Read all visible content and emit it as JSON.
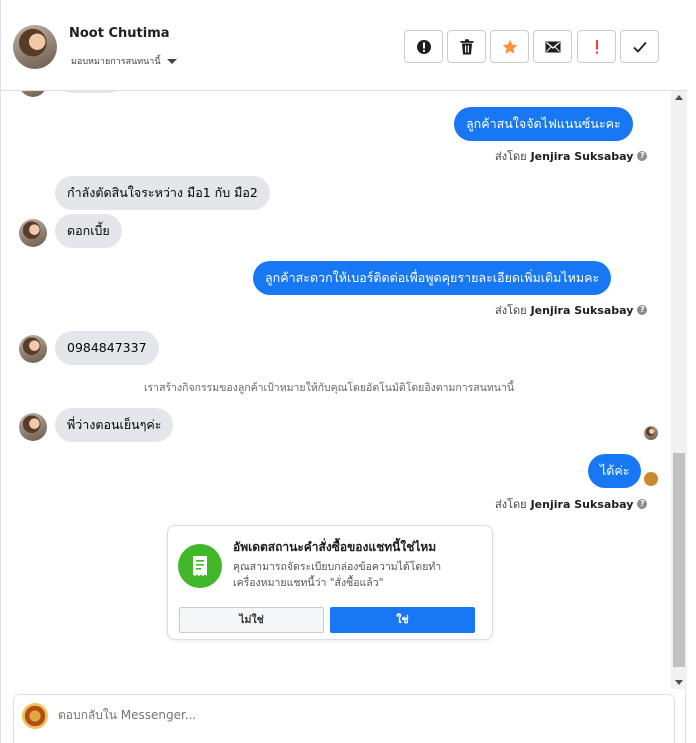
{
  "header": {
    "name": "Noot Chutima",
    "assign": "มอบหมายการสนทนานี้",
    "actions": [
      {
        "name": "mark-spam-button",
        "icon": "exclamation-circle-icon",
        "color": "#1c1e21"
      },
      {
        "name": "delete-button",
        "icon": "trash-icon",
        "color": "#1c1e21"
      },
      {
        "name": "star-button",
        "icon": "star-icon",
        "color": "#f7923b"
      },
      {
        "name": "mark-unread-button",
        "icon": "envelope-icon",
        "color": "#1c1e21"
      },
      {
        "name": "follow-up-button",
        "icon": "exclamation-icon",
        "color": "#fa383e"
      },
      {
        "name": "mark-done-button",
        "icon": "checkmark-icon",
        "color": "#1c1e21"
      }
    ]
  },
  "messages": {
    "m1": "ลูกค้าสนใจจัดไฟแนนซ์นะคะ",
    "m2": "กำลังตัดสินใจระหว่าง มือ1 กับ มือ2",
    "m3": "ดอกเบี้ย",
    "m4": "ลูกค้าสะดวกให้เบอร์ติดต่อเพื่อพูดคุยรายละเอียดเพิ่มเติมไหมคะ",
    "m5": "0984847337",
    "m6": "พี่ว่างตอนเย็นๆค่ะ",
    "m7": "ได้ค่ะ"
  },
  "sent_by": {
    "prefix": "ส่งโดย",
    "agent": "Jenjira Suksabay"
  },
  "system_note": "เราสร้างกิจกรรมของลูกค้าเป้าหมายให้กับคุณโดยอัตโนมัติโดยอิงตามการสนทนานี้",
  "card": {
    "title": "อัพเดตสถานะคำสั่งซื้อของแชทนี้ใช่ไหม",
    "desc": "คุณสามารถจัดระเบียบกล่องข้อความได้โดยทำเครื่องหมายแชทนี้ว่า \"สั่งซื้อแล้ว\"",
    "no": "ไม่ใช่",
    "yes": "ใช่",
    "icon": "receipt-icon",
    "icon_color": "#42b72a"
  },
  "composer": {
    "placeholder": "ตอบกลับใน Messenger..."
  },
  "colors": {
    "outgoing": "#1877f2",
    "incoming": "#e4e6eb"
  }
}
